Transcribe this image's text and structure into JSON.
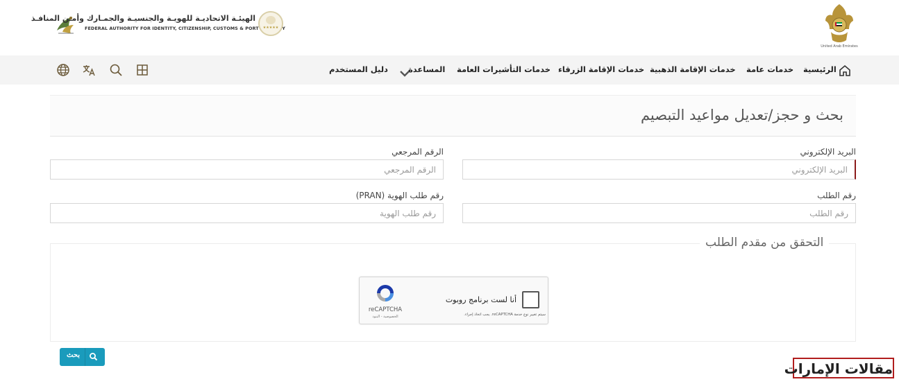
{
  "header": {
    "authority_name_ar": "الهيئـة الاتحاديـة للهويـة والجنسيـة والجمـارك وأمـن المنافـذ",
    "authority_name_en": "FEDERAL AUTHORITY FOR IDENTITY, CITIZENSHIP, CUSTOMS & PORT SECURITY",
    "emblem_caption": "United Arab Emirates",
    "stars_badge": "★★★★★"
  },
  "nav": {
    "items": [
      {
        "label": "الرئيسية",
        "icon": "home-icon"
      },
      {
        "label": "خدمات عامة"
      },
      {
        "label": "خدمات الإقامة الذهبية"
      },
      {
        "label": "خدمات الإقامة الزرقاء"
      },
      {
        "label": "خدمات التأشيرات العامة"
      },
      {
        "label": "المساعدة",
        "icon": "chevron-down-icon"
      },
      {
        "label": "دليل المستخدم"
      }
    ],
    "tools": [
      "grid-icon",
      "search-icon",
      "translate-icon",
      "globe-icon"
    ]
  },
  "page": {
    "title": "بحث و حجز/تعديل مواعيد التبصيم"
  },
  "form": {
    "email": {
      "label": "البريد الإلكتروني",
      "placeholder": "البريد الإلكتروني"
    },
    "reference": {
      "label": "الرقم المرجعي",
      "placeholder": "الرقم المرجعي"
    },
    "application": {
      "label": "رقم الطلب",
      "placeholder": "رقم الطلب"
    },
    "pran": {
      "label": "رقم طلب الهوية (PRAN)",
      "placeholder": "رقم طلب الهوية"
    }
  },
  "verification": {
    "legend": "التحقق من مقدم الطلب",
    "recaptcha": {
      "checkbox_label": "أنا لست برنامج روبوت",
      "brand": "reCAPTCHA",
      "privacy_terms": "الخصوصية - البنود",
      "notice": "سيتم تغيير نوع خدمة reCAPTCHA. يجب اتخاذ إجراء."
    }
  },
  "actions": {
    "search_label": "بحث"
  },
  "watermark": {
    "text": "مقالات الإمارات"
  },
  "colors": {
    "button": "#1a9bbc",
    "accent_border": "#8b1a1a",
    "watermark_border": "#b11d1d",
    "navbar_bg": "#f4f4f4"
  }
}
